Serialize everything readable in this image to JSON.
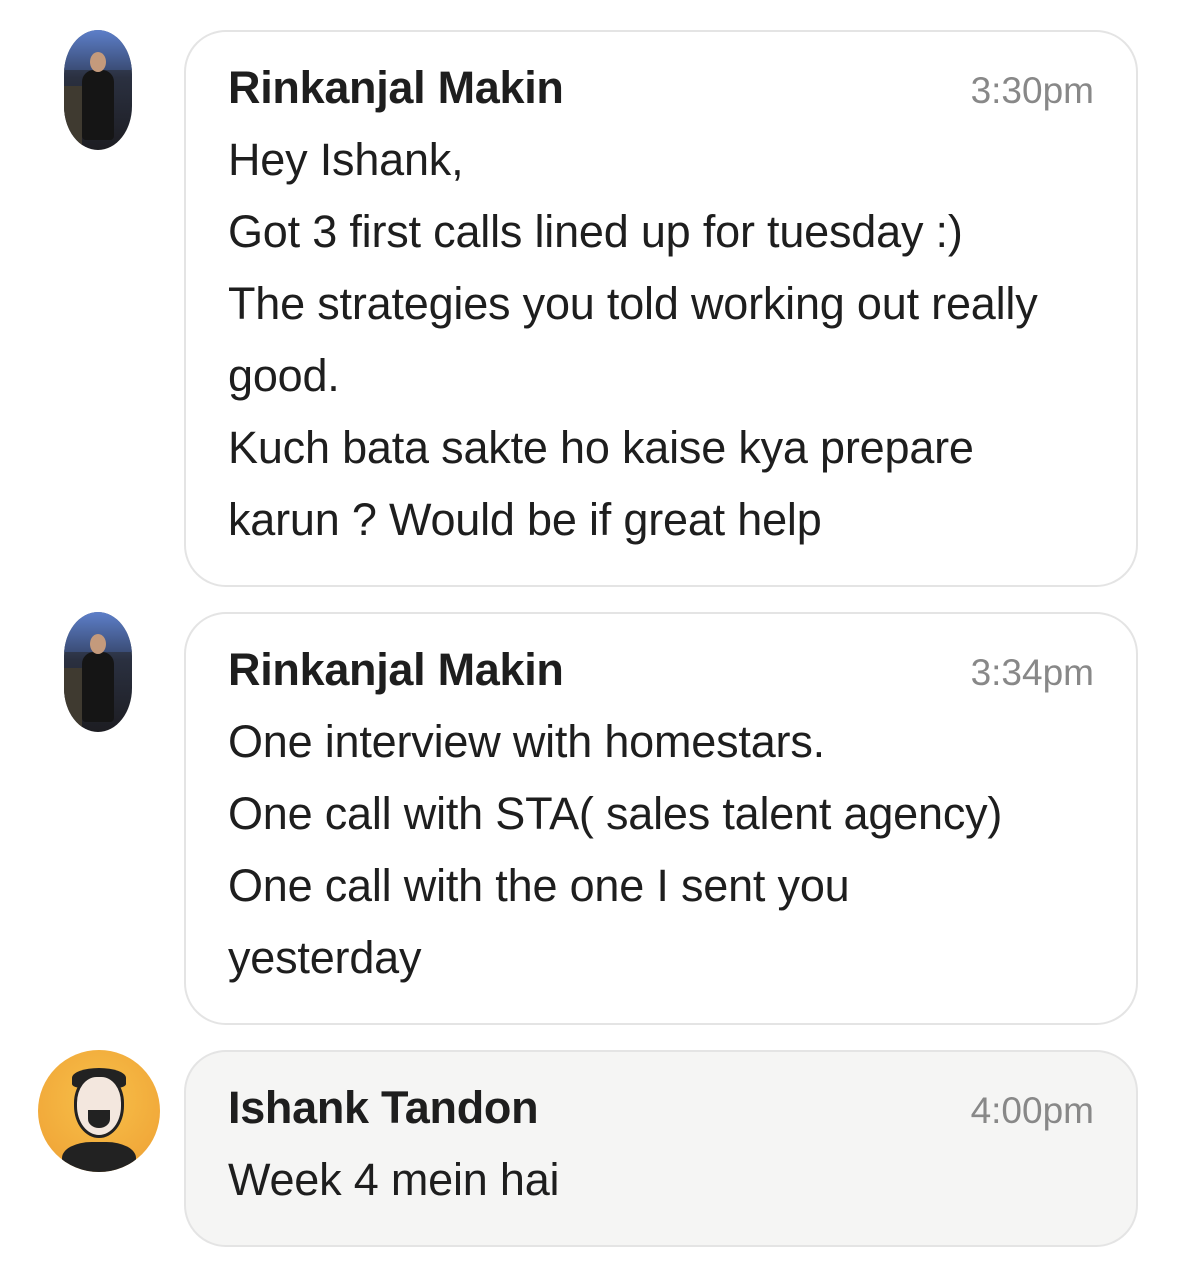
{
  "messages": [
    {
      "sender": "Rinkanjal Makin",
      "time": "3:30pm",
      "avatar": "profile-photo",
      "lines": [
        "Hey Ishank,",
        "Got 3 first calls lined up for tuesday :)",
        "The strategies you told working out really",
        "good.",
        "Kuch bata sakte ho kaise kya prepare",
        "karun ? Would be if great help"
      ]
    },
    {
      "sender": "Rinkanjal Makin",
      "time": "3:34pm",
      "avatar": "profile-photo",
      "lines": [
        "One interview with homestars.",
        "One call with STA( sales talent agency)",
        "One call with the one I sent you",
        "yesterday"
      ]
    },
    {
      "sender": "Ishank Tandon",
      "time": "4:00pm",
      "avatar": "cartoon-avatar",
      "lines": [
        "Week 4 mein hai"
      ]
    }
  ],
  "colors": {
    "bubble_border": "#e4e4e4",
    "own_bubble_bg": "#f5f5f4",
    "timestamp": "#888888",
    "avatar_yellow": "#f1a93a"
  }
}
